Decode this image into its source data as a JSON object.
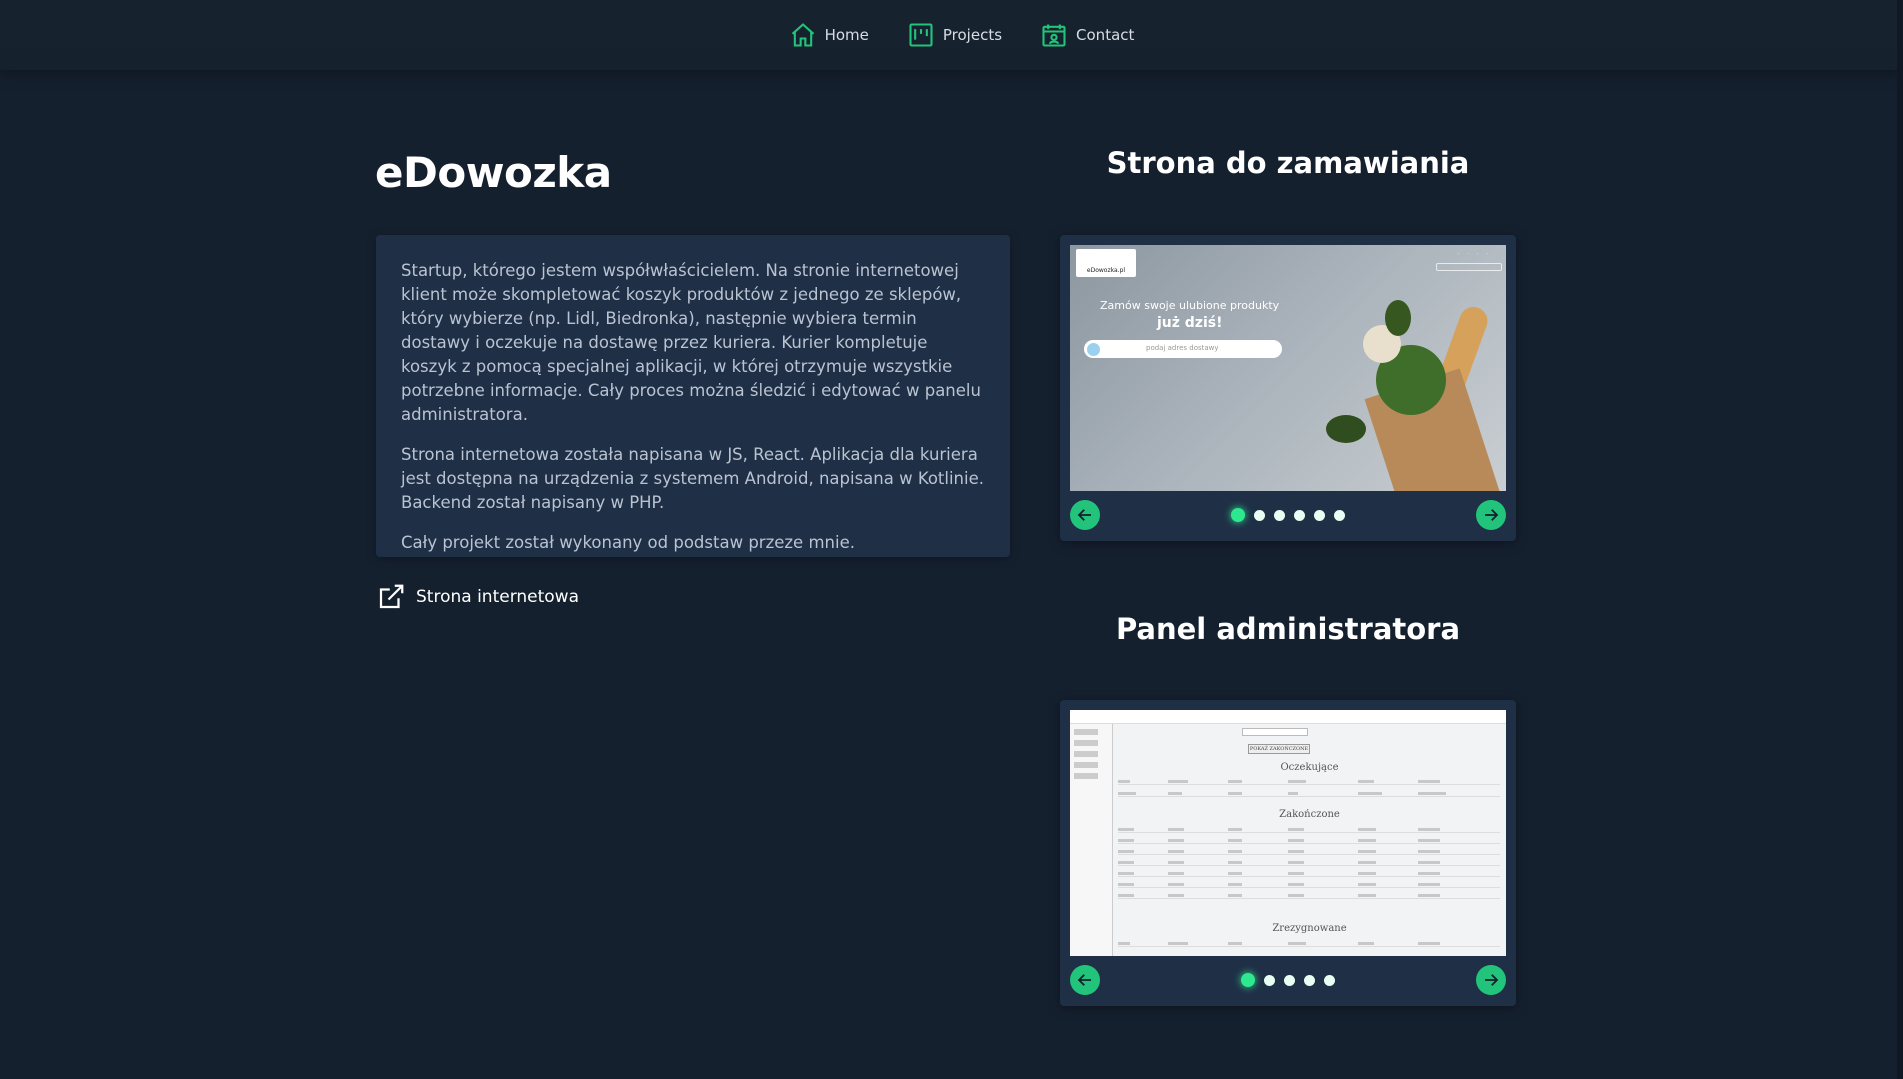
{
  "nav": {
    "items": [
      {
        "label": "Home",
        "icon": "home-icon"
      },
      {
        "label": "Projects",
        "icon": "kanban-icon"
      },
      {
        "label": "Contact",
        "icon": "contact-calendar-icon"
      }
    ],
    "accent": "#21c47a"
  },
  "project": {
    "title": "eDowozka",
    "paragraphs": [
      "Startup, którego jestem współwłaścicielem. Na stronie internetowej klient może skompletować koszyk produktów z jednego ze sklepów, który wybierze (np. Lidl, Biedronka), następnie wybiera termin dostawy i oczekuje na dostawę przez kuriera. Kurier kompletuje koszyk z pomocą specjalnej aplikacji, w której otrzymuje wszystkie potrzebne informacje. Cały proces można śledzić i edytować w panelu administratora.",
      "Strona internetowa została napisana w JS, React. Aplikacja dla kuriera jest dostępna na urządzenia z systemem Android, napisana w Kotlinie. Backend został napisany w PHP.",
      "Cały projekt został wykonany od podstaw przeze mnie."
    ],
    "link_label": "Strona internetowa"
  },
  "gallery1": {
    "title": "Strona do zamawiania",
    "dots": 6,
    "active_index": 0,
    "slide": {
      "logo": "eDowozka.pl",
      "headline": "Zamów swoje ulubione produkty",
      "headline2": "już dziś!",
      "search_placeholder": "podaj adres dostawy"
    }
  },
  "gallery2": {
    "title": "Panel administratora",
    "dots": 5,
    "active_index": 0,
    "slide": {
      "button": "POKAŻ ZAKOŃCZONE",
      "section1": "Oczekujące",
      "section2": "Zakończone",
      "section3": "Zrezygnowane"
    }
  }
}
